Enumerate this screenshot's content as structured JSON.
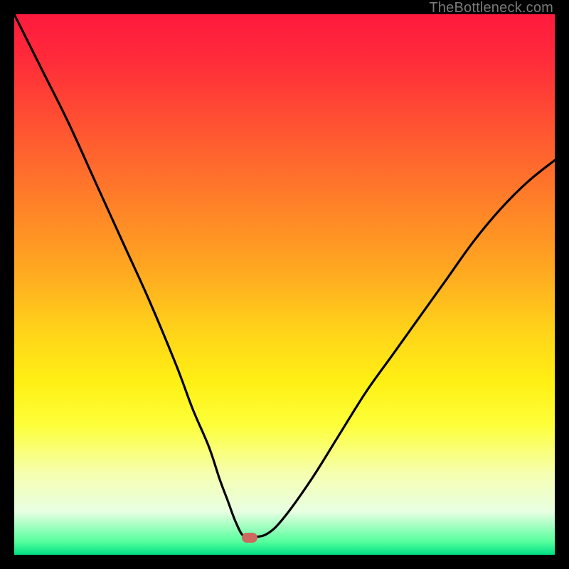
{
  "watermark": {
    "text": "TheBottleneck.com"
  },
  "marker": {
    "x_pct": 43.6,
    "y_pct": 96.8,
    "color": "#cd6a5f"
  },
  "chart_data": {
    "type": "line",
    "title": "",
    "xlabel": "",
    "ylabel": "",
    "xlim": [
      0,
      100
    ],
    "ylim": [
      0,
      100
    ],
    "series": [
      {
        "name": "bottleneck-curve",
        "x": [
          0,
          5,
          10,
          15,
          20,
          25,
          30,
          33,
          36,
          38,
          39.5,
          41,
          42.5,
          44.5,
          47,
          50,
          55,
          60,
          65,
          70,
          75,
          80,
          85,
          90,
          95,
          100
        ],
        "y": [
          100,
          90,
          80,
          69,
          58,
          47,
          35,
          27,
          20,
          14,
          10,
          6,
          3.4,
          3.3,
          4,
          7,
          14,
          22,
          30,
          37,
          44,
          51,
          58,
          64,
          69,
          73
        ]
      }
    ],
    "gradient_stops": [
      {
        "pos": 0.0,
        "color": "#ff1a3e"
      },
      {
        "pos": 0.5,
        "color": "#ffd11a"
      },
      {
        "pos": 0.8,
        "color": "#fdff3a"
      },
      {
        "pos": 0.97,
        "color": "#58ff9e"
      },
      {
        "pos": 1.0,
        "color": "#00e084"
      }
    ]
  }
}
